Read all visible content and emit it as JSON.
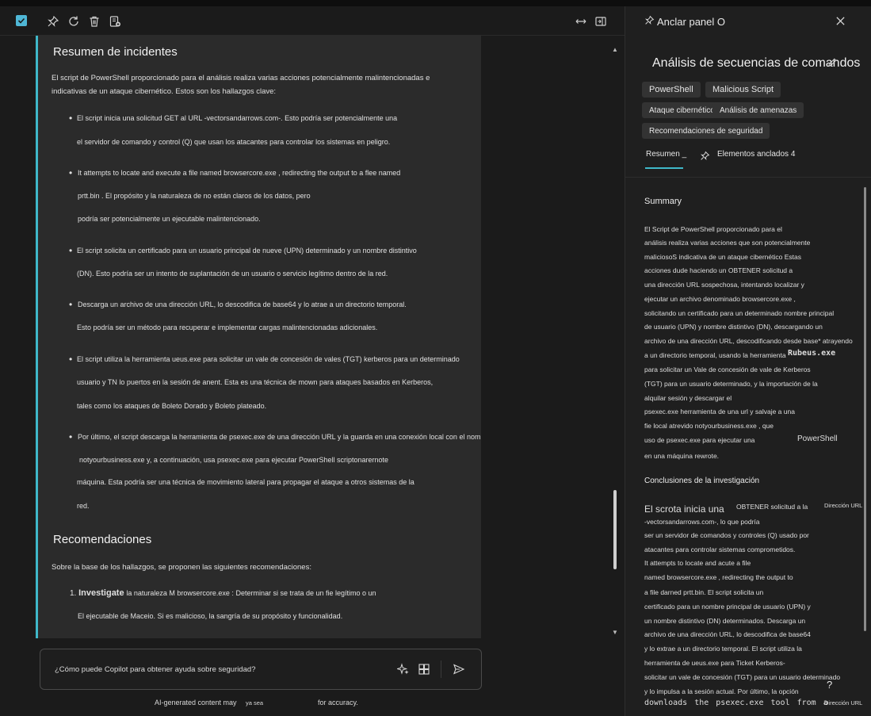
{
  "toolbar": {
    "icons": [
      "checkbox-icon",
      "pin-icon",
      "refresh-icon",
      "trash-icon",
      "export-icon",
      "expand-icon",
      "collapse-panel-icon"
    ]
  },
  "incidents": {
    "title": "Resumen de incidentes",
    "intro1": "El script de PowerShell proporcionado para el análisis realiza varias acciones potencialmente malintencionadas e",
    "intro2": "indicativas de un ataque cibernético. Estos son los hallazgos clave:",
    "b1_l1": "El script inicia una solicitud GET al URL -vectorsandarrows.com-. Esto podría ser potencialmente una",
    "b1_l2": "el servidor de comando y control (Q) que usan los atacantes para controlar los sistemas en peligro.",
    "b2_l1": "It attempts to locate and execute a file named browsercore.exe , redirecting the output to a flee named",
    "b2_l2": "prtt.bin . El propósito y la naturaleza de no están claros de los datos, pero",
    "b2_l3": "podría ser potencialmente un ejecutable malintencionado.",
    "b3_l1": "El script solicita un certificado para un usuario principal de nueve (UPN) determinado y un nombre distintivo",
    "b3_l2": "(DN). Esto podría ser un intento de suplantación de un usuario o servicio legítimo dentro de la red.",
    "b4_l1": "Descarga un archivo de una dirección URL, lo descodifica de base64 y lo atrae a un directorio temporal.",
    "b4_l2": "Esto podría ser un método para recuperar e implementar cargas malintencionadas adicionales.",
    "b5_l1": "El script utiliza la herramienta ueus.exe para solicitar un vale de concesión de vales (TGT) kerberos para un determinado",
    "b5_l2": "usuario y TN lo puertos en la sesión de anent. Esta es una técnica de mown para ataques basados en Kerberos,",
    "b5_l3": "tales como los ataques de Boleto Dorado y Boleto plateado.",
    "b6_l1": "Por último, el script descarga la herramienta de psexec.exe de una dirección URL y la guarda en una conexión local con el nombre",
    "b6_l2": "notyourbusiness.exe y, a continuación, usa psexec.exe para ejecutar PowerShell scriptonarernote",
    "b6_l3": "máquina. Esta podría ser una técnica de movimiento lateral para propagar el ataque a otros sistemas de la",
    "b6_l4": "red."
  },
  "recommendations": {
    "title": "Recomendaciones",
    "intro": "Sobre la base de los hallazgos, se proponen las siguientes recomendaciones:",
    "n1_num": "1.",
    "n1_strong": "Investigate",
    "n1_rest": "la naturaleza M browsercore.exe : Determinar si se trata de un fie legítimo o un",
    "n1_l2": "El ejecutable de Maceio. Si es malicioso, la sangría de su propósito y funcionalidad."
  },
  "composer": {
    "placeholder": "¿Cómo puede Copilot para obtener ayuda sobre seguridad?",
    "disclaimer_a": "AI-generated content may",
    "disclaimer_b": "ya sea",
    "disclaimer_c": "for accuracy."
  },
  "panel": {
    "pin_label": "Anclar panel O",
    "title": "Análisis de secuencias de comandos",
    "tags": [
      "PowerShell",
      "Malicious Script",
      "Ataque cibernético",
      "Análisis de amenazas",
      "Recomendaciones de seguridad"
    ],
    "tab_summary": "Resumen",
    "tab_summary_mark": "_",
    "tab_pinned": "Elementos anclados 4",
    "summary_title": "Summary",
    "s": [
      "El        Script de PowerShell proporcionado para el",
      "análisis realiza varias acciones que son potencialmente",
      "maliciosoS indicativa de un ataque cibernético Estas",
      "acciones dude haciendo un               OBTENER solicitud a",
      "una dirección URL sospechosa, intentando localizar y",
      "ejecutar un archivo denominado browsercore.exe ,",
      "solicitando un certificado para un determinado nombre principal",
      "de usuario (UPN) y nombre distintivo (DN), descargando un",
      "archivo de una dirección URL, descodificando desde base* atrayendo",
      "a un directorio temporal, usando la herramienta",
      "para solicitar un          Vale de concesión de vale de Kerberos",
      "(TGT) para un usuario determinado, y la importación de la",
      "alquilar sesión y descargar el",
      " psexec.exe herramienta de una url y salvaje a una",
      "fie local atrevido notyourbusiness.exe , que",
      "uso de psexec.exe para ejecutar una",
      "en una máquina rewrote."
    ],
    "rubeus": "Rubeus.exe",
    "powershell_inline": "PowerShell",
    "conclusions_title": "Conclusiones de la investigación",
    "c_big_a": "El scrota inicia una",
    "c_big_b": "OBTENER solicitud a la",
    "c_url": "Dirección URL",
    "c": [
      "-vectorsandarrows.com-, lo que podría",
      "ser un servidor de comandos y controles (Q) usado por",
      "atacantes para controlar sistemas comprometidos.",
      "It attempts to locate and acute a file",
      " named browsercore.exe , redirecting the output to",
      "a file darned prtt.bin.              El script solicita un",
      "certificado para un nombre principal de usuario (UPN) y",
      "un nombre distintivo (DN) determinados. Descarga un",
      "archivo de una dirección URL, lo descodifica de base64",
      "y lo extrae a un directorio temporal. El script utiliza la",
      " herramienta de ueus.exe para              Ticket Kerberos-",
      "solicitar un vale de concesión (TGT) para un usuario determinado",
      "y lo impulsa a la sesión actual.            Por último, la opción"
    ],
    "last_line": "downloads the psexec.exe tool from a",
    "last_url": "Dirección URL",
    "help": "?"
  }
}
